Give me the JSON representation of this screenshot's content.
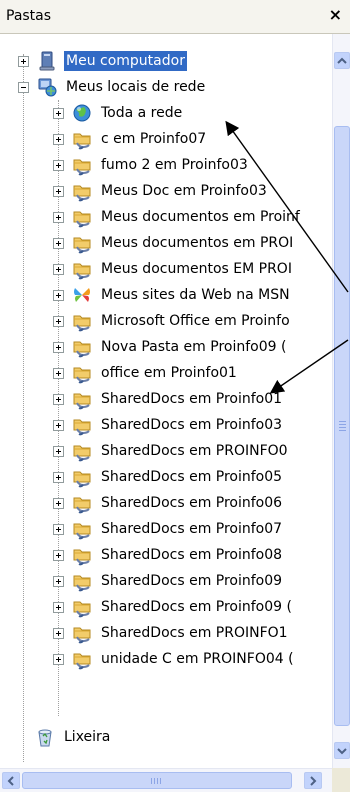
{
  "panel": {
    "title": "Pastas",
    "close_symbol": "×"
  },
  "tree": {
    "meu_computador": "Meu computador",
    "meus_locais": "Meus locais de rede",
    "items": [
      {
        "label": "Toda a rede",
        "icon": "network-globe-icon"
      },
      {
        "label": "c em Proinfo07",
        "icon": "shared-folder-icon"
      },
      {
        "label": "fumo 2 em Proinfo03",
        "icon": "shared-folder-icon"
      },
      {
        "label": "Meus Doc em Proinfo03",
        "icon": "shared-folder-icon"
      },
      {
        "label": "Meus documentos em Proinf",
        "icon": "shared-folder-icon"
      },
      {
        "label": "Meus documentos em PROI",
        "icon": "shared-folder-icon"
      },
      {
        "label": "Meus documentos EM PROI",
        "icon": "shared-folder-icon"
      },
      {
        "label": "Meus sites da Web na MSN",
        "icon": "msn-butterfly-icon"
      },
      {
        "label": "Microsoft Office em Proinfo",
        "icon": "shared-folder-icon"
      },
      {
        "label": "Nova Pasta em Proinfo09 (",
        "icon": "shared-folder-icon"
      },
      {
        "label": "office em Proinfo01",
        "icon": "shared-folder-icon"
      },
      {
        "label": "SharedDocs em Proinfo01",
        "icon": "shared-folder-icon"
      },
      {
        "label": "SharedDocs em Proinfo03",
        "icon": "shared-folder-icon"
      },
      {
        "label": "SharedDocs em PROINFO0",
        "icon": "shared-folder-icon"
      },
      {
        "label": "SharedDocs em Proinfo05",
        "icon": "shared-folder-icon"
      },
      {
        "label": "SharedDocs em Proinfo06",
        "icon": "shared-folder-icon"
      },
      {
        "label": "SharedDocs em Proinfo07",
        "icon": "shared-folder-icon"
      },
      {
        "label": "SharedDocs em Proinfo08",
        "icon": "shared-folder-icon"
      },
      {
        "label": "SharedDocs em Proinfo09",
        "icon": "shared-folder-icon"
      },
      {
        "label": "SharedDocs em Proinfo09 (",
        "icon": "shared-folder-icon"
      },
      {
        "label": "SharedDocs em PROINFO1",
        "icon": "shared-folder-icon"
      },
      {
        "label": "unidade C em PROINFO04 (",
        "icon": "shared-folder-icon"
      }
    ],
    "lixeira": "Lixeira"
  },
  "colors": {
    "selection": "#316ac5",
    "scrollbar": "#c2d3fc",
    "arrow": "#000000"
  }
}
